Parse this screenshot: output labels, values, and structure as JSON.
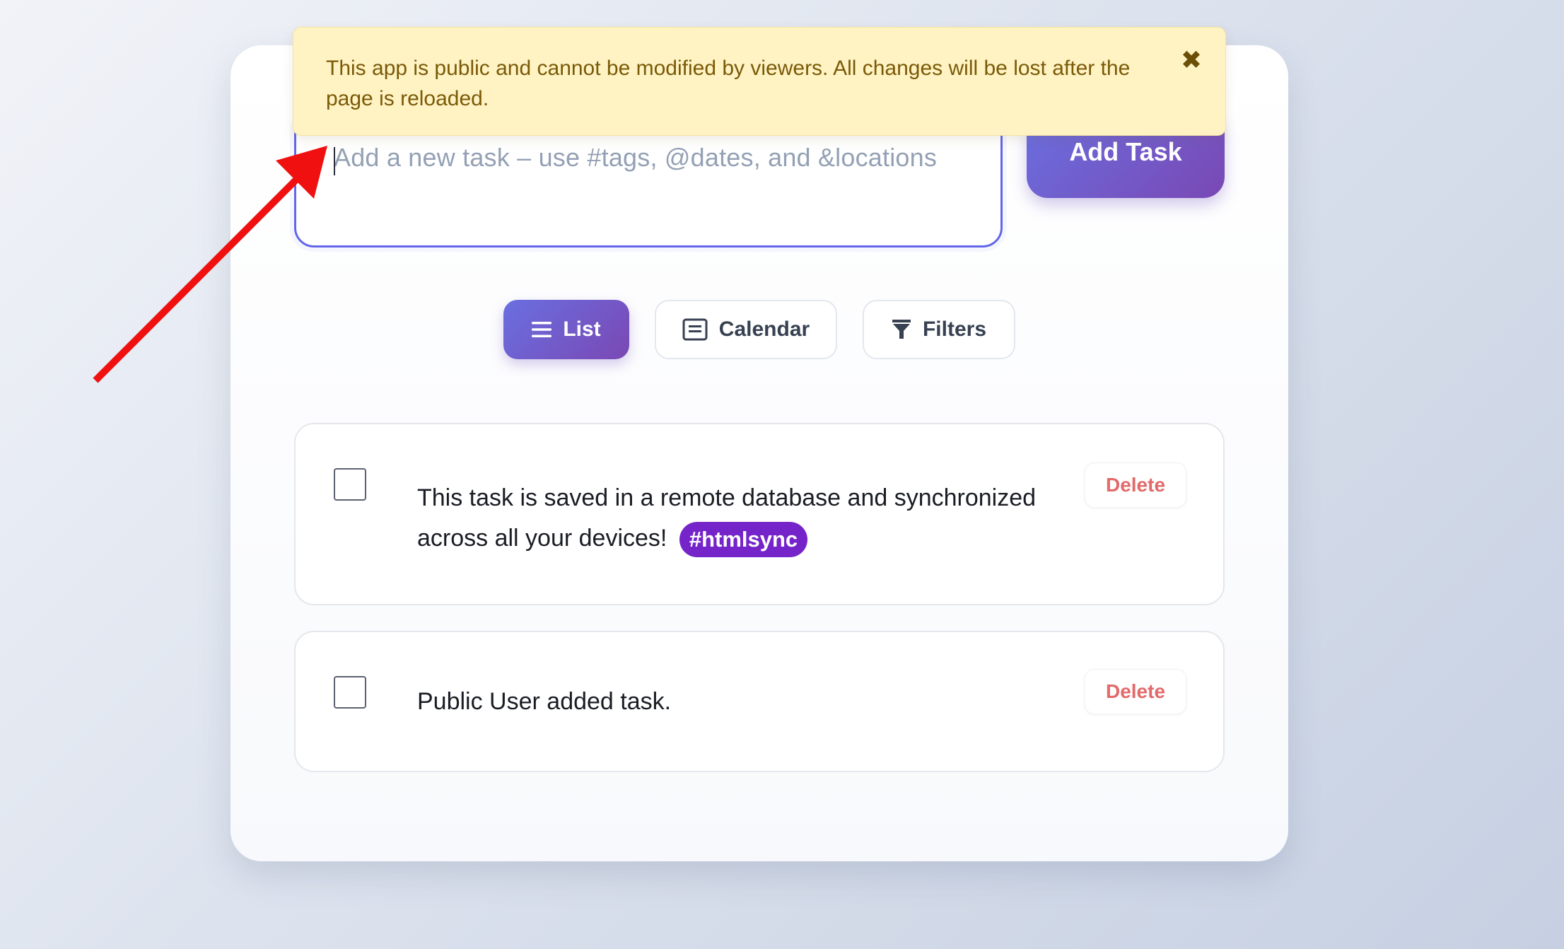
{
  "banner": {
    "message": "This app is public and cannot be modified by viewers. All changes will be lost after the page is reloaded.",
    "close_glyph": "✖"
  },
  "task_input": {
    "placeholder": "Add a new task – use #tags, @dates, and &locations",
    "value": ""
  },
  "add_task_button": {
    "label": "Add Task"
  },
  "view_toggle": {
    "list": {
      "label": "List",
      "icon": "list-icon",
      "active": true
    },
    "calendar": {
      "label": "Calendar",
      "icon": "calendar-icon",
      "active": false
    },
    "filters": {
      "label": "Filters",
      "icon": "funnel-icon",
      "active": false
    }
  },
  "tasks": [
    {
      "text": "This task is saved in a remote database and synchronized across all your devices!",
      "tag": "#htmlsync",
      "checked": false,
      "delete_label": "Delete"
    },
    {
      "text": "Public User added task.",
      "tag": "",
      "checked": false,
      "delete_label": "Delete"
    }
  ],
  "colors": {
    "accent_gradient_start": "#6a6fe0",
    "accent_gradient_end": "#7a48b4",
    "tag_background": "#7424c8",
    "delete_text": "#e26a6a",
    "banner_background": "#fff3c4",
    "banner_text": "#7a5a08",
    "annotation_arrow": "#f01010"
  }
}
